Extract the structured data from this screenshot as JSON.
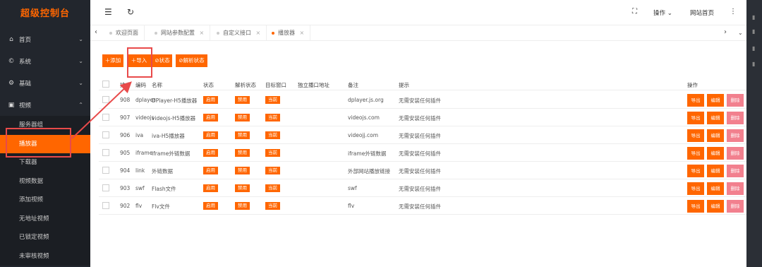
{
  "sidebar": {
    "brand": "超级控制台",
    "top_items": [
      {
        "label": "首页",
        "icon": "home-icon"
      },
      {
        "label": "系统",
        "icon": "system-icon"
      },
      {
        "label": "基础",
        "icon": "gear-icon"
      },
      {
        "label": "视频",
        "icon": "video-icon"
      }
    ],
    "sub_items": [
      "服务器组",
      "播放器",
      "下载器",
      "视频数据",
      "添加视频",
      "无地址视频",
      "已锁定视频",
      "未审核视频"
    ],
    "active_sub": "播放器"
  },
  "topbar": {
    "menu_icon": "☰",
    "refresh_icon": "↻",
    "fullscreen_icon": "⛶",
    "operate_label": "操作",
    "site_home_label": "网站首页",
    "more_icon": "⋮"
  },
  "tabs": [
    {
      "label": "欢迎页面",
      "closable": false
    },
    {
      "label": "网站参数配置",
      "closable": true
    },
    {
      "label": "自定义接口",
      "closable": true
    },
    {
      "label": "播放器",
      "closable": true,
      "active": true
    }
  ],
  "toolbar": {
    "add_label": "＋添加",
    "import_label": "＋导入",
    "status_label": "⊘状态",
    "parse_status_label": "⊘解析状态"
  },
  "table": {
    "headers": [
      "排序",
      "编码",
      "名称",
      "状态",
      "解析状态",
      "目标窗口",
      "独立播口地址",
      "备注",
      "提示",
      "操作"
    ],
    "rows": [
      {
        "sort": "908",
        "code": "dplayer",
        "name": "DPlayer-H5播放器",
        "status": "启用",
        "parse": "禁用",
        "target": "当前",
        "remark": "dplayer.js.org",
        "tip": "无需安装任何插件"
      },
      {
        "sort": "907",
        "code": "videojs",
        "name": "videojs-H5播放器",
        "status": "启用",
        "parse": "禁用",
        "target": "当前",
        "remark": "videojs.com",
        "tip": "无需安装任何插件"
      },
      {
        "sort": "906",
        "code": "iva",
        "name": "iva-H5播放器",
        "status": "启用",
        "parse": "禁用",
        "target": "当前",
        "remark": "videojj.com",
        "tip": "无需安装任何插件"
      },
      {
        "sort": "905",
        "code": "iframe",
        "name": "iframe外链数据",
        "status": "启用",
        "parse": "禁用",
        "target": "当前",
        "remark": "iframe外链数据",
        "tip": "无需安装任何插件"
      },
      {
        "sort": "904",
        "code": "link",
        "name": "外链数据",
        "status": "启用",
        "parse": "禁用",
        "target": "当前",
        "remark": "外部网站播放链接",
        "tip": "无需安装任何插件"
      },
      {
        "sort": "903",
        "code": "swf",
        "name": "Flash文件",
        "status": "启用",
        "parse": "禁用",
        "target": "当前",
        "remark": "swf",
        "tip": "无需安装任何插件"
      },
      {
        "sort": "902",
        "code": "flv",
        "name": "Flv文件",
        "status": "启用",
        "parse": "禁用",
        "target": "当前",
        "remark": "flv",
        "tip": "无需安装任何插件"
      }
    ],
    "action_labels": {
      "export": "导出",
      "edit": "编辑",
      "delete": "删除"
    }
  },
  "colors": {
    "accent": "#ff6600",
    "sidebar_bg": "#22262d",
    "annotation": "#e84a4a"
  }
}
